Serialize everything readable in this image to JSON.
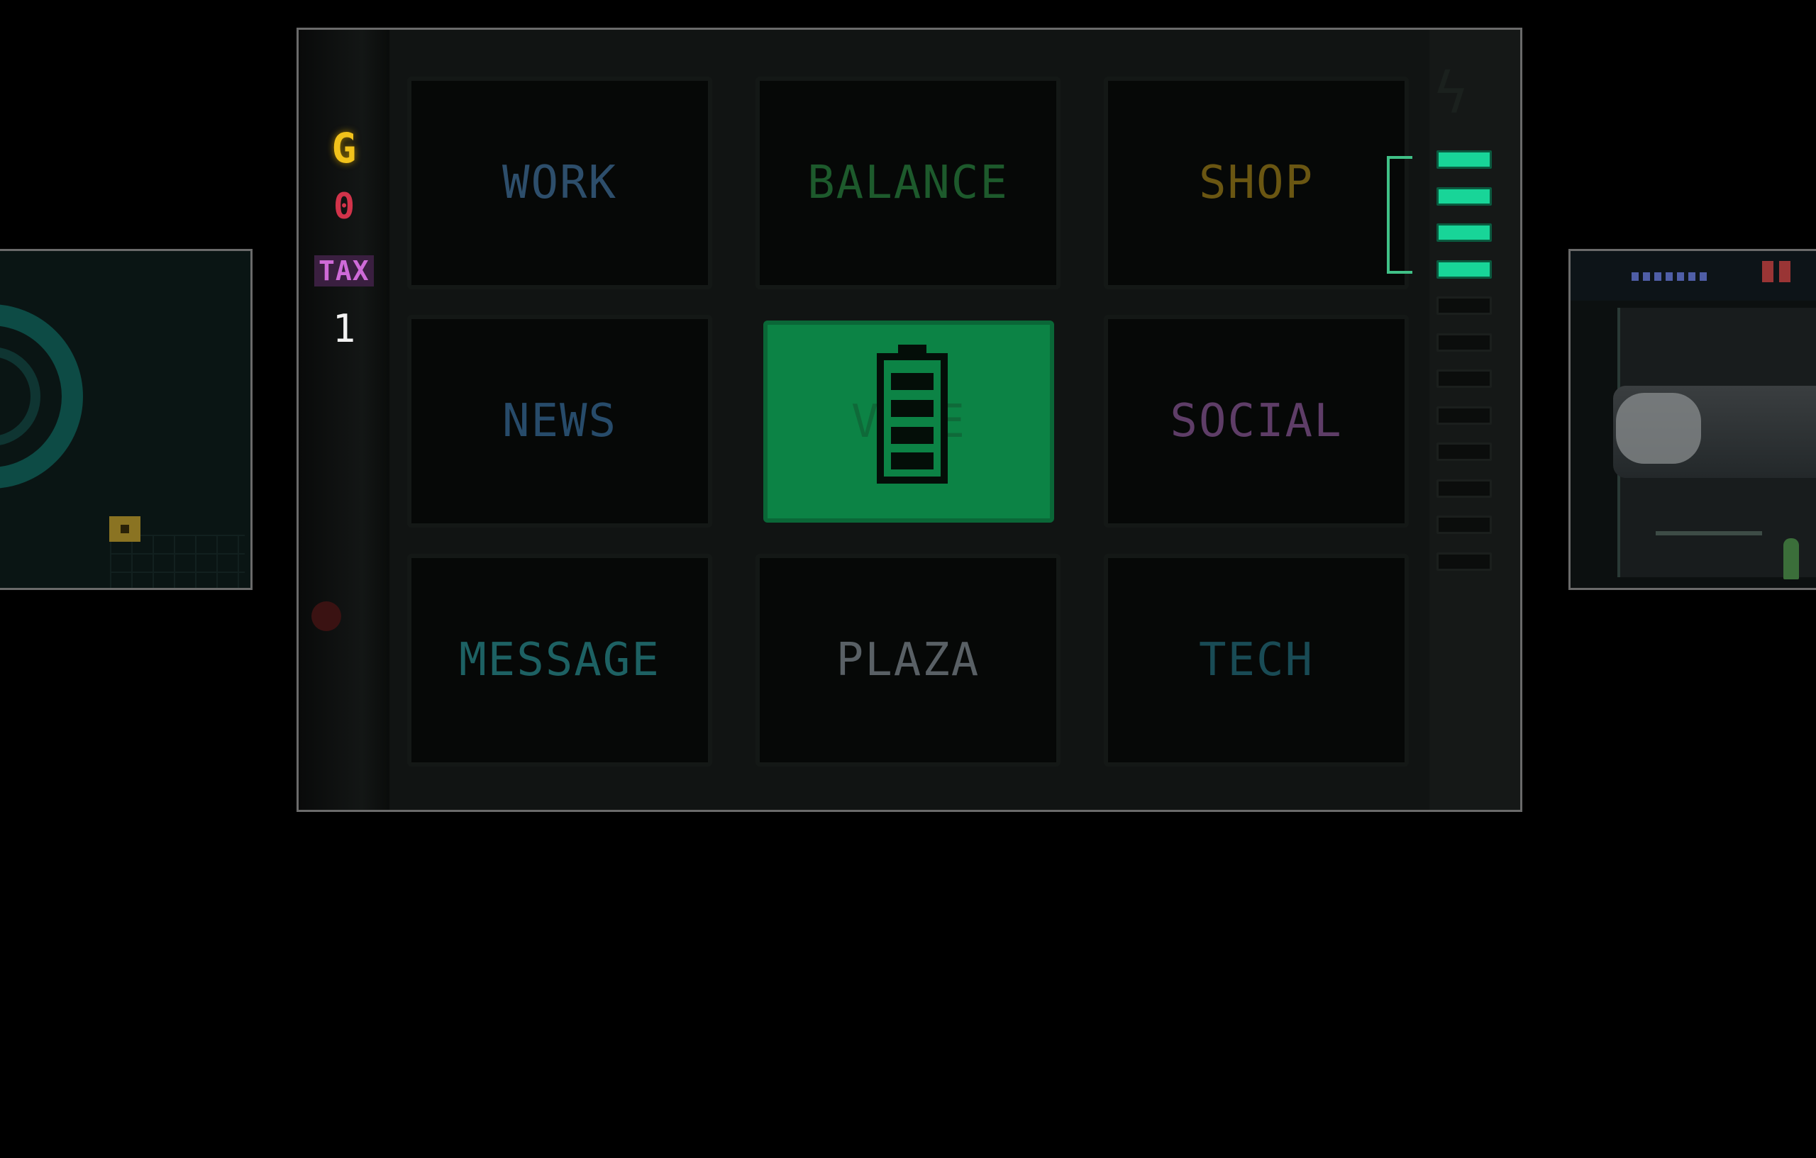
{
  "stats": {
    "currency_symbol": "G",
    "gold": "0",
    "tax_label": "TAX",
    "tax": "1"
  },
  "menu": {
    "work": "WORK",
    "balance": "BALANCE",
    "shop": "SHOP",
    "news": "NEWS",
    "vote": "VOTE",
    "social": "SOCIAL",
    "message": "MESSAGE",
    "plaza": "PLAZA",
    "tech": "TECH"
  },
  "power_level": {
    "filled": 4,
    "total": 12
  },
  "colors": {
    "vote_active": "#0c8345",
    "level_on": "#18d598",
    "currency": "#f1c21b",
    "gold": "#d1334a",
    "tax": "#cf6ad8"
  }
}
